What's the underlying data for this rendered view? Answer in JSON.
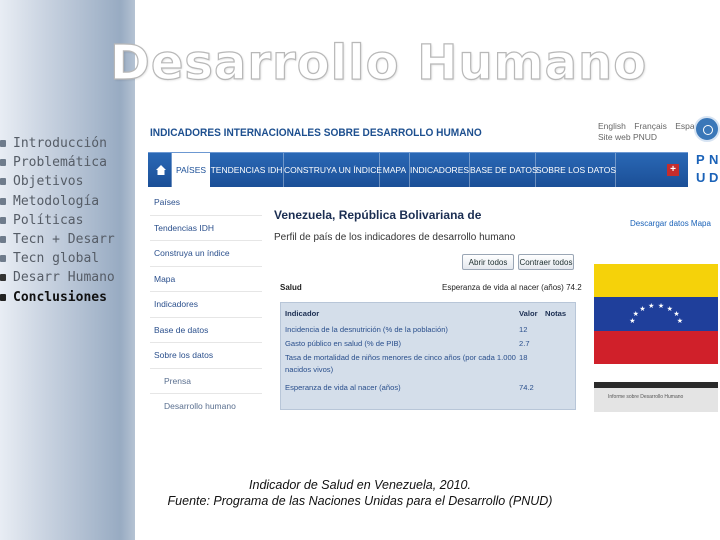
{
  "slide": {
    "title": "Desarrollo Humano",
    "outline": [
      {
        "label": "Introducción",
        "state": "normal"
      },
      {
        "label": "Problemática",
        "state": "normal"
      },
      {
        "label": "Objetivos",
        "state": "normal"
      },
      {
        "label": "Metodología",
        "state": "normal"
      },
      {
        "label": "Políticas",
        "state": "normal"
      },
      {
        "label": "Tecn + Desarr",
        "state": "normal"
      },
      {
        "label": "Tecn global",
        "state": "normal"
      },
      {
        "label": "Desarr Humano",
        "state": "dark"
      },
      {
        "label": "Conclusiones",
        "state": "active"
      }
    ],
    "caption_line1": "Indicador de Salud en  Venezuela, 2010.",
    "caption_line2": "Fuente: Programa de las Naciones Unidas para el Desarrollo (PNUD)"
  },
  "website": {
    "header_title": "INDICADORES INTERNACIONALES SOBRE DESARROLLO HUMANO",
    "languages_line1": [
      "English",
      "Français",
      "Español"
    ],
    "languages_line2": "Site web PNUD",
    "logo_letters": [
      "P",
      "N",
      "U",
      "D"
    ],
    "nav": {
      "home_icon": "home-icon",
      "items": [
        "PAÍSES",
        "TENDENCIAS IDH",
        "CONSTRUYA UN ÍNDICE",
        "MAPA",
        "INDICADORES",
        "BASE DE DATOS",
        "SOBRE LOS DATOS"
      ],
      "active": "PAÍSES",
      "expand_label": "+"
    },
    "sidebar_menu": [
      {
        "label": "Países",
        "sub": false
      },
      {
        "label": "Tendencias IDH",
        "sub": false
      },
      {
        "label": "Construya un índice",
        "sub": false
      },
      {
        "label": "Mapa",
        "sub": false
      },
      {
        "label": "Indicadores",
        "sub": false
      },
      {
        "label": "Base de datos",
        "sub": false
      },
      {
        "label": "Sobre los datos",
        "sub": false
      },
      {
        "label": "Prensa",
        "sub": true
      },
      {
        "label": "Desarrollo humano",
        "sub": true
      }
    ],
    "country_title": "Venezuela, República Bolivariana de",
    "country_subtitle": "Perfil de país de los indicadores de desarrollo humano",
    "download_link": "Descargar datos  Mapa",
    "buttons": {
      "expand": "Abrir todos",
      "collapse": "Contraer todos"
    },
    "health": {
      "section_label": "Salud",
      "summary": "Esperanza de vida al nacer (años) 74.2",
      "columns": [
        "Indicador",
        "Valor",
        "Notas"
      ],
      "rows": [
        {
          "indicator": "Incidencia de la desnutrición (% de la población)",
          "value": "12",
          "notes": ""
        },
        {
          "indicator": "Gasto público en salud (% de PIB)",
          "value": "2.7",
          "notes": ""
        },
        {
          "indicator": "Tasa de mortalidad de niños menores de cinco años (por cada 1.000",
          "indicator_cont": "nacidos vivos)",
          "value": "18",
          "notes": ""
        },
        {
          "indicator": "Esperanza de vida al nacer (años)",
          "value": "74.2",
          "notes": ""
        }
      ]
    },
    "flag": {
      "colors": [
        "#f5d20a",
        "#1f3f9b",
        "#d0202a"
      ],
      "star_color": "#ffffff",
      "star_count": 8
    },
    "banner_text": "Informe sobre Desarrollo Humano"
  },
  "colors": {
    "nav_blue": "#1b4f97",
    "title_blue": "#1d4f8f",
    "link_blue": "#1a62b8"
  }
}
